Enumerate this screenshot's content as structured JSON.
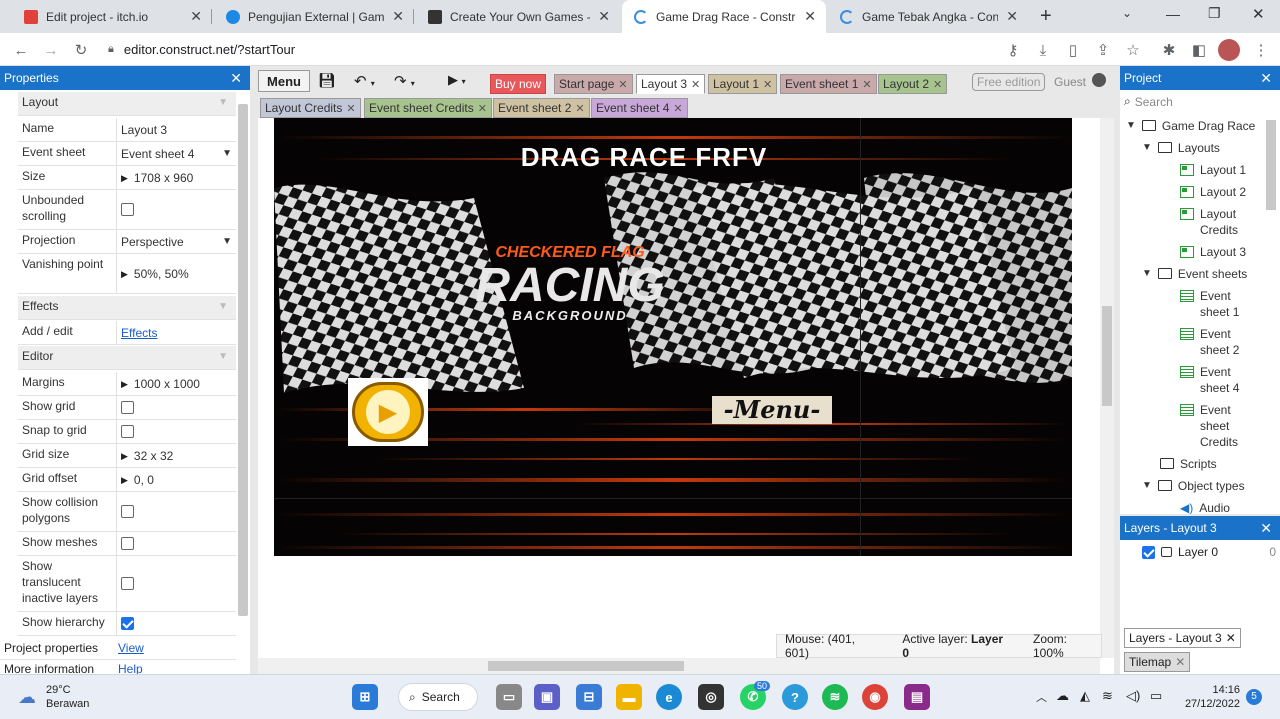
{
  "browser": {
    "tabs": [
      {
        "title": "Edit project - itch.io",
        "fav": "#e0413a"
      },
      {
        "title": "Pengujian External | Gamelab",
        "fav": "#1e88e5"
      },
      {
        "title": "Create Your Own Games - Fre",
        "fav": "#333333"
      },
      {
        "title": "Game Drag Race - Construct",
        "fav": "#3b8de0"
      },
      {
        "title": "Game Tebak Angka - Constru",
        "fav": "#3b8de0"
      }
    ],
    "new_tab": "+",
    "url": "editor.construct.net/?startTour"
  },
  "construct": {
    "properties": {
      "title": "Properties",
      "rows": [
        {
          "type": "section",
          "label": "Layout"
        },
        {
          "label": "Name",
          "value": "Layout 3"
        },
        {
          "label": "Event sheet",
          "value": "Event sheet 4",
          "dropdown": true
        },
        {
          "label": "Size",
          "value": "1708 x 960",
          "expand": true
        },
        {
          "label": "Unbounded scrolling",
          "check": false
        },
        {
          "label": "Projection",
          "value": "Perspective",
          "dropdown": true
        },
        {
          "label": "Vanishing point",
          "value": "50%, 50%",
          "expand": true
        },
        {
          "type": "section",
          "label": "Effects"
        },
        {
          "label": "Add / edit",
          "link": "Effects"
        },
        {
          "type": "section",
          "label": "Editor"
        },
        {
          "label": "Margins",
          "value": "1000 x 1000",
          "expand": true
        },
        {
          "label": "Show grid",
          "check": false
        },
        {
          "label": "Snap to grid",
          "check": false
        },
        {
          "label": "Grid size",
          "value": "32 x 32",
          "expand": true
        },
        {
          "label": "Grid offset",
          "value": "0, 0",
          "expand": true
        },
        {
          "label": "Show collision polygons",
          "check": false
        },
        {
          "label": "Show meshes",
          "check": false
        },
        {
          "label": "Show translucent inactive layers",
          "check": false
        },
        {
          "label": "Show hierarchy",
          "check": true
        }
      ],
      "project_properties": "Project properties",
      "project_link": "View",
      "more_info": "More information",
      "more_link": "Help"
    },
    "toolbar": {
      "menu": "Menu",
      "tabs_row1": [
        {
          "label": "Buy now",
          "bg": "#e8585a",
          "fg": "#ffffff",
          "close": false
        },
        {
          "label": "Start page",
          "bg": "#c9a9a9",
          "close": true
        },
        {
          "label": "Layout 3",
          "bg": "#ffffff",
          "close": true,
          "active": true
        },
        {
          "label": "Layout 1",
          "bg": "#cfc2a2",
          "close": true
        },
        {
          "label": "Event sheet 1",
          "bg": "#c9a9a9",
          "close": true
        },
        {
          "label": "Layout 2",
          "bg": "#a8c48e",
          "close": true
        }
      ],
      "tabs_row2": [
        {
          "label": "Layout Credits",
          "bg": "#c2c7d8",
          "close": true
        },
        {
          "label": "Event sheet Credits",
          "bg": "#a8c48e",
          "close": true
        },
        {
          "label": "Event sheet 2",
          "bg": "#cfc2a2",
          "close": true
        },
        {
          "label": "Event sheet 4",
          "bg": "#c8a8d8",
          "close": true
        }
      ],
      "free_edition": "Free edition",
      "guest": "Guest"
    },
    "layout_view": {
      "title_text": "DRAG RACE FRFV",
      "logo_top": "CHECKERED FLAG",
      "logo_main": "RACING",
      "logo_sub": "BACKGROUND",
      "menu_label": "-Menu-"
    },
    "status": {
      "mouse": "Mouse: (401, 601)",
      "active_layer_label": "Active layer:",
      "active_layer": "Layer 0",
      "zoom": "Zoom: 100%"
    },
    "project": {
      "title": "Project",
      "search_placeholder": "Search",
      "tree": {
        "root": "Game Drag Race",
        "layouts_folder": "Layouts",
        "layouts": [
          "Layout 1",
          "Layout 2",
          "Layout Credits",
          "Layout 3"
        ],
        "events_folder": "Event sheets",
        "events": [
          "Event sheet 1",
          "Event sheet 2",
          "Event sheet 4",
          "Event sheet Credits"
        ],
        "scripts": "Scripts",
        "object_types": "Object types",
        "audio": "Audio"
      }
    },
    "layers": {
      "title": "Layers - Layout 3",
      "layer_name": "Layer 0",
      "layer_index": "0",
      "bottom_tabs": [
        "Layers - Layout 3",
        "Tilemap"
      ]
    }
  },
  "taskbar": {
    "temp": "29°C",
    "weather": "Berawan",
    "search": "Search",
    "time": "14:16",
    "date": "27/12/2022",
    "badge_whatsapp": "50",
    "badge_notif": "5"
  }
}
